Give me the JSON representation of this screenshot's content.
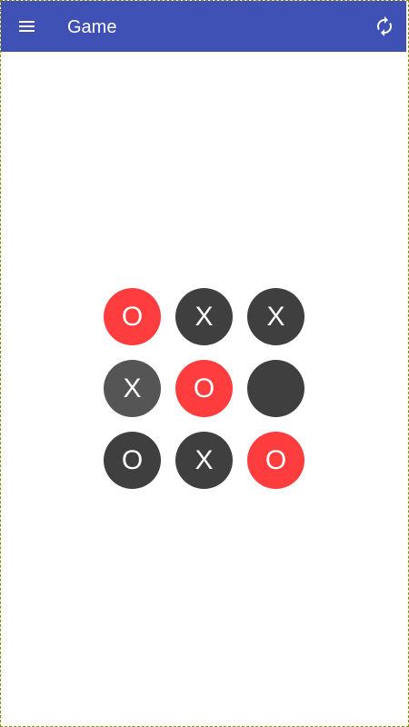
{
  "app_bar": {
    "title": "Game",
    "menu_icon": "menu-icon",
    "refresh_icon": "refresh-icon",
    "color": "#3f51b5"
  },
  "board": {
    "colors": {
      "dark": "#3f3f3f",
      "highlight": "#ff3d3f",
      "hover": "#555555"
    },
    "cells": [
      {
        "mark": "O",
        "state": "highlight"
      },
      {
        "mark": "X",
        "state": "dark"
      },
      {
        "mark": "X",
        "state": "dark"
      },
      {
        "mark": "X",
        "state": "hover"
      },
      {
        "mark": "O",
        "state": "highlight"
      },
      {
        "mark": "",
        "state": "dark"
      },
      {
        "mark": "O",
        "state": "dark"
      },
      {
        "mark": "X",
        "state": "dark"
      },
      {
        "mark": "O",
        "state": "highlight"
      }
    ]
  }
}
